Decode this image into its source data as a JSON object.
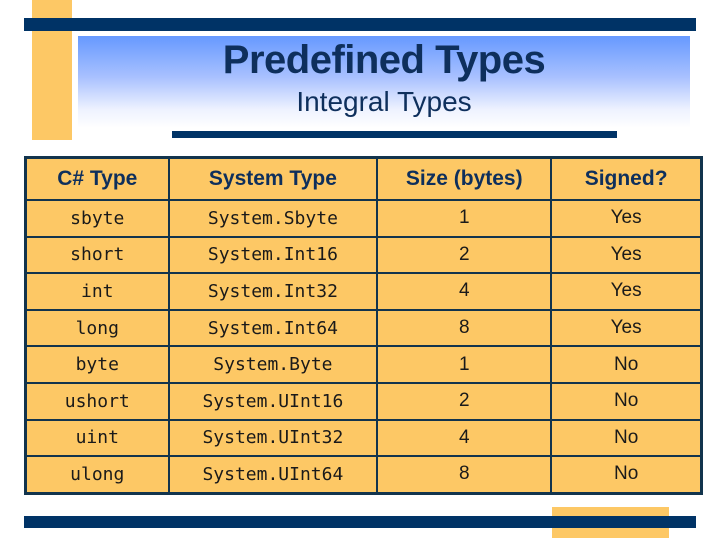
{
  "slide": {
    "title": "Predefined Types",
    "subtitle": "Integral Types",
    "colors": {
      "navy": "#003366",
      "accent_yellow": "#fdc865",
      "title_text": "#0e2f5c",
      "gradient_top": "#6699ff"
    }
  },
  "table": {
    "headers": [
      "C# Type",
      "System Type",
      "Size (bytes)",
      "Signed?"
    ],
    "rows": [
      [
        "sbyte",
        "System.Sbyte",
        "1",
        "Yes"
      ],
      [
        "short",
        "System.Int16",
        "2",
        "Yes"
      ],
      [
        "int",
        "System.Int32",
        "4",
        "Yes"
      ],
      [
        "long",
        "System.Int64",
        "8",
        "Yes"
      ],
      [
        "byte",
        "System.Byte",
        "1",
        "No"
      ],
      [
        "ushort",
        "System.UInt16",
        "2",
        "No"
      ],
      [
        "uint",
        "System.UInt32",
        "4",
        "No"
      ],
      [
        "ulong",
        "System.UInt64",
        "8",
        "No"
      ]
    ]
  }
}
